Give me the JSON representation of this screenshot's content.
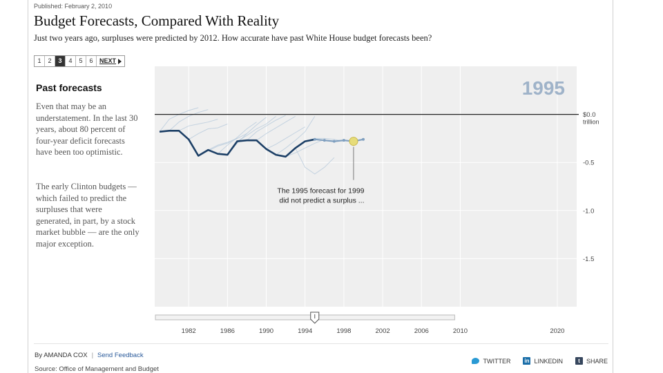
{
  "published": "Published: February 2, 2010",
  "headline": "Budget Forecasts, Compared With Reality",
  "deck": "Just two years ago, surpluses were predicted by 2012. How accurate have past White House budget forecasts been?",
  "pager": {
    "pages": [
      "1",
      "2",
      "3",
      "4",
      "5",
      "6"
    ],
    "active_index": 2,
    "next_label": "NEXT"
  },
  "sidebar": {
    "title": "Past forecasts",
    "paragraph1": "Even that may be an understatement. In the last 30 years, about 80 percent of four-year deficit forecasts have been too optimistic.",
    "paragraph2": "The early Clinton budgets — which failed to predict the surpluses that were generated, in part, by a stock market bubble — are the only major exception."
  },
  "chart_data": {
    "type": "line",
    "current_year_label": "1995",
    "y_tick_labels": [
      "$0.0",
      "-0.5",
      "-1.0",
      "-1.5"
    ],
    "y_unit_label": "trillion",
    "y_ticks": [
      0,
      -0.5,
      -1.0,
      -1.5
    ],
    "ylim": [
      0.5,
      -2.0
    ],
    "xlim": [
      1978.5,
      2022
    ],
    "x_tick_labels": [
      "1982",
      "1986",
      "1990",
      "1994",
      "1998",
      "2002",
      "2006",
      "2010",
      "2020"
    ],
    "x_ticks": [
      1982,
      1986,
      1990,
      1994,
      1998,
      2002,
      2006,
      2010,
      2020
    ],
    "series": [
      {
        "role": "actual",
        "color": "#1c3f66",
        "x": [
          1979,
          1980,
          1981,
          1982,
          1983,
          1984,
          1985,
          1986,
          1987,
          1988,
          1989,
          1990,
          1991,
          1992,
          1993,
          1994,
          1995
        ],
        "y": [
          -0.18,
          -0.17,
          -0.17,
          -0.26,
          -0.43,
          -0.37,
          -0.41,
          -0.42,
          -0.28,
          -0.27,
          -0.27,
          -0.36,
          -0.42,
          -0.44,
          -0.35,
          -0.28,
          -0.26
        ]
      },
      {
        "role": "forecast-1995",
        "color": "#7f9fbf",
        "x": [
          1995,
          1996,
          1997,
          1998,
          1999,
          2000
        ],
        "y": [
          -0.26,
          -0.27,
          -0.28,
          -0.27,
          -0.28,
          -0.26
        ]
      }
    ],
    "past_forecasts": [
      {
        "x": [
          1979,
          1980,
          1981,
          1982,
          1983
        ],
        "y": [
          -0.18,
          -0.05,
          0.0,
          0.04,
          0.07
        ]
      },
      {
        "x": [
          1980,
          1981,
          1982,
          1983,
          1984
        ],
        "y": [
          -0.17,
          -0.08,
          -0.02,
          0.02,
          0.05
        ]
      },
      {
        "x": [
          1981,
          1982,
          1983,
          1984,
          1985
        ],
        "y": [
          -0.17,
          -0.12,
          -0.1,
          -0.08,
          -0.05
        ]
      },
      {
        "x": [
          1982,
          1983,
          1984,
          1985,
          1986
        ],
        "y": [
          -0.26,
          -0.2,
          -0.15,
          -0.14,
          -0.1
        ]
      },
      {
        "x": [
          1983,
          1984,
          1985,
          1986,
          1987
        ],
        "y": [
          -0.43,
          -0.38,
          -0.33,
          -0.3,
          -0.25
        ]
      },
      {
        "x": [
          1984,
          1985,
          1986,
          1987,
          1988
        ],
        "y": [
          -0.37,
          -0.32,
          -0.29,
          -0.25,
          -0.2
        ]
      },
      {
        "x": [
          1985,
          1986,
          1987,
          1988,
          1989
        ],
        "y": [
          -0.41,
          -0.32,
          -0.24,
          -0.15,
          -0.08
        ]
      },
      {
        "x": [
          1986,
          1987,
          1988,
          1989,
          1990
        ],
        "y": [
          -0.42,
          -0.3,
          -0.2,
          -0.11,
          -0.03
        ]
      },
      {
        "x": [
          1987,
          1988,
          1989,
          1990,
          1991
        ],
        "y": [
          -0.28,
          -0.22,
          -0.15,
          -0.1,
          -0.02
        ]
      },
      {
        "x": [
          1988,
          1989,
          1990,
          1991,
          1992
        ],
        "y": [
          -0.27,
          -0.18,
          -0.12,
          -0.06,
          -0.01
        ]
      },
      {
        "x": [
          1989,
          1990,
          1991,
          1992,
          1993
        ],
        "y": [
          -0.27,
          -0.2,
          -0.14,
          -0.08,
          -0.02
        ]
      },
      {
        "x": [
          1990,
          1991,
          1992,
          1993,
          1994
        ],
        "y": [
          -0.36,
          -0.31,
          -0.25,
          -0.19,
          -0.13
        ]
      },
      {
        "x": [
          1991,
          1992,
          1993,
          1994,
          1995
        ],
        "y": [
          -0.42,
          -0.35,
          -0.27,
          -0.18,
          -0.02
        ]
      },
      {
        "x": [
          1992,
          1993,
          1994,
          1995,
          1996
        ],
        "y": [
          -0.44,
          -0.4,
          -0.35,
          -0.3,
          -0.26
        ]
      },
      {
        "x": [
          1993,
          1994,
          1995,
          1996,
          1997
        ],
        "y": [
          -0.35,
          -0.55,
          -0.62,
          -0.55,
          -0.45
        ]
      },
      {
        "x": [
          1994,
          1995,
          1996,
          1997,
          1998
        ],
        "y": [
          -0.28,
          -0.25,
          -0.25,
          -0.26,
          -0.28
        ]
      }
    ],
    "highlight": {
      "x": 1999,
      "y": -0.28,
      "color": "#e6dc7a"
    },
    "annotation": "The 1995 forecast for 1999 did not predict a surplus ...",
    "annotation_lines": [
      "The 1995 forecast for 1999",
      "did not predict a surplus ..."
    ],
    "slider": {
      "min": 1979,
      "max": 2009,
      "value": 1995
    },
    "grid": true,
    "colors": {
      "background": "#efefef",
      "zero_line": "#222222",
      "grid": "#ffffff",
      "faint_forecast": "#b8cadc"
    }
  },
  "byline": {
    "author": "By AMANDA COX",
    "feedback_link": "Send Feedback",
    "source": "Source: Office of Management and Budget"
  },
  "share": {
    "twitter": "TWITTER",
    "linkedin": "LINKEDIN",
    "share": "SHARE",
    "linkedin_glyph": "in",
    "tumblr_glyph": "t"
  }
}
